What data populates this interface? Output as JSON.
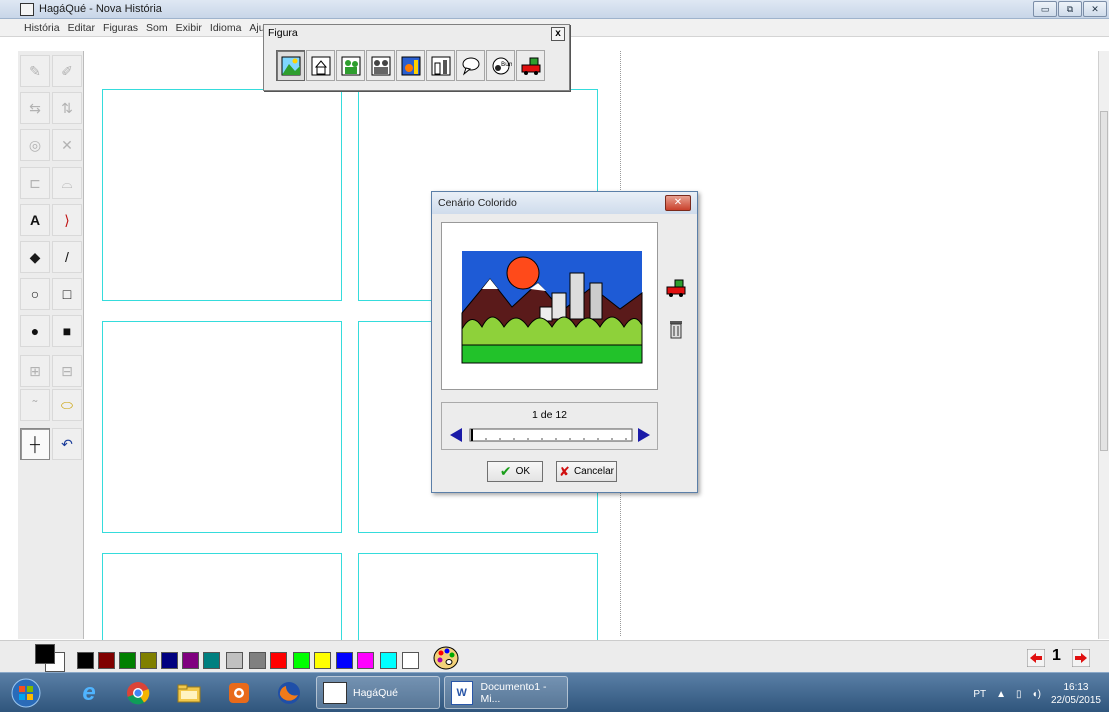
{
  "window": {
    "title": "HagáQué - Nova História",
    "controls": [
      "▭",
      "⧉",
      "✕"
    ]
  },
  "menu": [
    "História",
    "Editar",
    "Figuras",
    "Som",
    "Exibir",
    "Idioma",
    "Aju"
  ],
  "toolbar": {
    "tools": [
      {
        "name": "draw-pencil-tool",
        "glyph": "✎",
        "state": "dim"
      },
      {
        "name": "freehand-tool",
        "glyph": "✐",
        "state": "dim"
      },
      {
        "name": "flip-horizontal-tool",
        "glyph": "⇆",
        "state": "dim"
      },
      {
        "name": "flip-vertical-tool",
        "glyph": "⇅",
        "state": "dim"
      },
      {
        "name": "rotate-tool",
        "glyph": "◎",
        "state": "dim"
      },
      {
        "name": "shrink-tool",
        "glyph": "✕",
        "state": "dim"
      },
      {
        "name": "layer-tool",
        "glyph": "⊏",
        "state": "dim"
      },
      {
        "name": "cylinder-tool",
        "glyph": "⌓",
        "state": "dim"
      },
      {
        "name": "text-tool",
        "glyph": "A",
        "state": "active"
      },
      {
        "name": "curve-tool",
        "glyph": "⟩",
        "state": "active"
      },
      {
        "name": "paint-bucket-tool",
        "glyph": "◆",
        "state": "active"
      },
      {
        "name": "line-tool",
        "glyph": "/",
        "state": "active"
      },
      {
        "name": "circle-outline-tool",
        "glyph": "○",
        "state": "active"
      },
      {
        "name": "square-outline-tool",
        "glyph": "□",
        "state": "active"
      },
      {
        "name": "circle-filled-tool",
        "glyph": "●",
        "state": "active"
      },
      {
        "name": "square-filled-tool",
        "glyph": "■",
        "state": "active"
      },
      {
        "name": "bring-front-tool",
        "glyph": "⊞",
        "state": "dim"
      },
      {
        "name": "send-back-tool",
        "glyph": "⊟",
        "state": "dim"
      },
      {
        "name": "small-tool",
        "glyph": "˜",
        "state": "dim"
      },
      {
        "name": "eraser-tool",
        "glyph": "⬭",
        "state": "active"
      },
      {
        "name": "select-tool",
        "glyph": "┼",
        "state": "pressed"
      },
      {
        "name": "undo-tool",
        "glyph": "↶",
        "state": "active"
      }
    ]
  },
  "figura": {
    "title": "Figura",
    "close": "x",
    "buttons": [
      "scenery-icon",
      "house-icon",
      "people-icon",
      "crowd-icon",
      "characters-icon",
      "objects-icon",
      "speech-balloon-icon",
      "sound-icon",
      "truck-icon"
    ]
  },
  "dialog": {
    "title": "Cenário Colorido",
    "close": "✕",
    "counter": "1 de 12",
    "ok_label": "OK",
    "cancel_label": "Cancelar"
  },
  "palette": {
    "colors": [
      "#000000",
      "#800000",
      "#008000",
      "#808000",
      "#000080",
      "#800080",
      "#008080",
      "#c0c0c0",
      "#808080",
      "#ff0000",
      "#00ff00",
      "#ffff00",
      "#0000ff",
      "#ff00ff",
      "#00ffff",
      "#ffffff"
    ],
    "foreground": "#000000",
    "background": "#ffffff"
  },
  "page": {
    "number": "1"
  },
  "taskbar": {
    "tasks": [
      {
        "label": "HagáQué"
      },
      {
        "label": "Documento1 - Mi..."
      }
    ],
    "lang": "PT",
    "time": "16:13",
    "date": "22/05/2015"
  },
  "colors": {
    "panel_border": "#35dcdc",
    "accent_taskbar": "#2f557c"
  }
}
